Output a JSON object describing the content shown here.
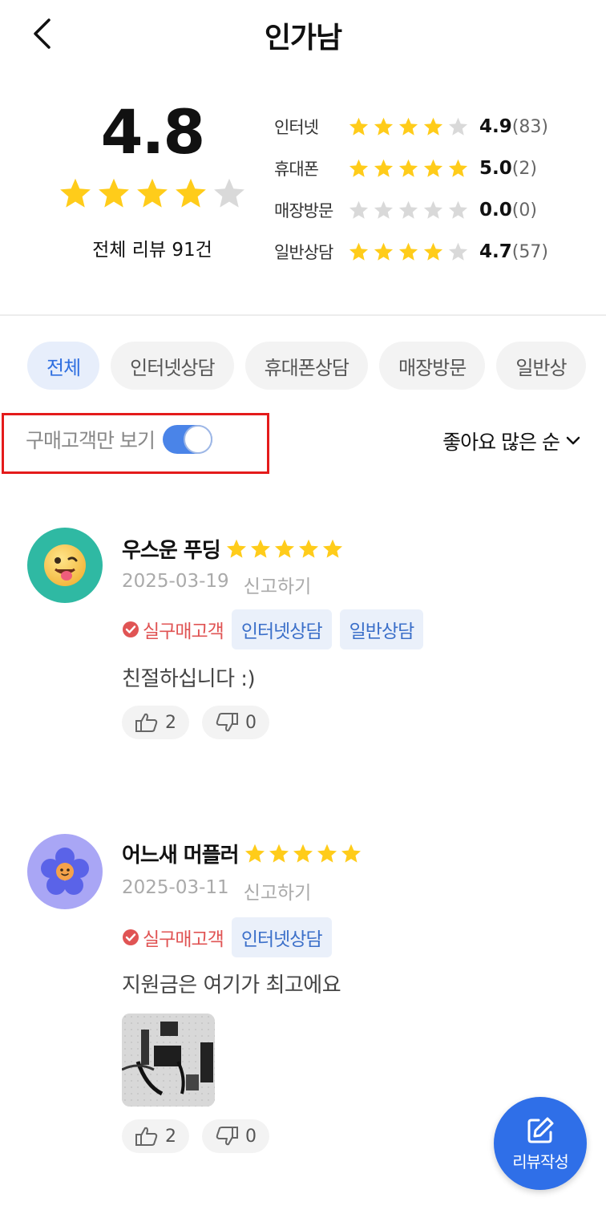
{
  "header": {
    "title": "인가남",
    "back_icon": "chevron-left-icon"
  },
  "summary": {
    "overall_score": "4.8",
    "overall_rating": 4,
    "total_reviews": "전체 리뷰 91건",
    "breakdown": [
      {
        "label": "인터넷",
        "rating": 4,
        "score": "4.9",
        "count": "(83)"
      },
      {
        "label": "휴대폰",
        "rating": 5,
        "score": "5.0",
        "count": "(2)"
      },
      {
        "label": "매장방문",
        "rating": 0,
        "score": "0.0",
        "count": "(0)"
      },
      {
        "label": "일반상담",
        "rating": 4,
        "score": "4.7",
        "count": "(57)"
      }
    ]
  },
  "filters": {
    "chips": [
      "전체",
      "인터넷상담",
      "휴대폰상담",
      "매장방문",
      "일반상"
    ],
    "active_chip": "전체",
    "buyer_only_label": "구매고객만 보기",
    "buyer_only_on": true,
    "sort_label": "좋아요 많은 순"
  },
  "reviews": [
    {
      "name": "우스운 푸딩",
      "rating": 5,
      "date": "2025-03-19",
      "report": "신고하기",
      "verified": "실구매고객",
      "tags": [
        "인터넷상담",
        "일반상담"
      ],
      "text": "친절하십니다 :)",
      "likes": "2",
      "dislikes": "0",
      "avatar_icon": "tongue-face-icon"
    },
    {
      "name": "어느새 머플러",
      "rating": 5,
      "date": "2025-03-11",
      "report": "신고하기",
      "verified": "실구매고객",
      "tags": [
        "인터넷상담"
      ],
      "text": "지원금은 여기가 최고에요",
      "likes": "2",
      "dislikes": "0",
      "avatar_icon": "flower-face-icon",
      "has_photo": true
    }
  ],
  "fab": {
    "label": "리뷰작성",
    "icon": "edit-icon"
  },
  "colors": {
    "star_filled": "#FFCC1A",
    "star_empty": "#D9D9D9",
    "accent": "#2F6FE8",
    "verified": "#E05454",
    "highlight_box": "#E41B1B"
  }
}
